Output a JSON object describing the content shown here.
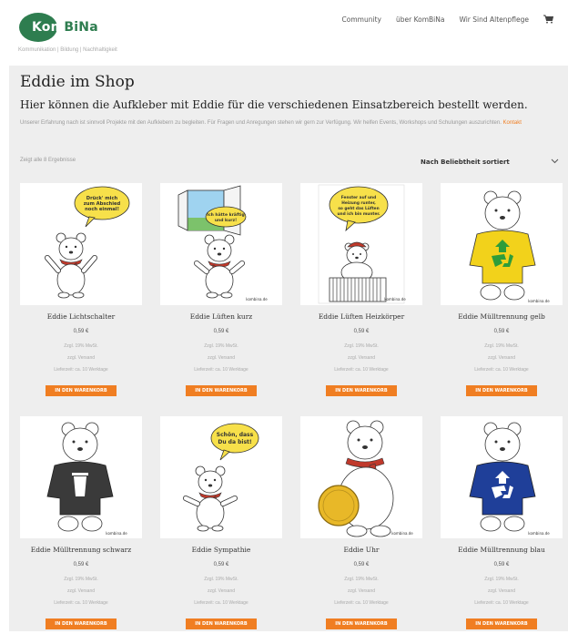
{
  "header": {
    "logo": {
      "part1": "Kom",
      "part2": "BiNa"
    },
    "tagline": "Kommunikation | Bildung | Nachhaltigkeit",
    "nav": [
      "Community",
      "über KomBiNa",
      "Wir Sind Altenpflege"
    ],
    "cart_icon": "shopping-cart-icon"
  },
  "page": {
    "title": "Eddie im Shop",
    "subtitle": "Hier können die Aufkleber mit Eddie für die verschiedenen Einsatzbereich bestellt werden.",
    "intro_text": "Unserer Erfahrung nach ist sinnvoll Projekte mit den Aufklebern zu begleiten. Für Fragen und Anregungen stehen wir gern zur Verfügung. Wir helfen Events, Workshops und Schulungen auszurichten.",
    "intro_link": "Kontakt",
    "result_count": "Zeigt alle 8 Ergebnisse",
    "sort_label": "Nach Beliebtheit sortiert"
  },
  "product_common": {
    "tax": "Zzgl. 19% MwSt.",
    "shipping": "zzgl. Versand",
    "delivery": "Lieferzeit: ca. 10 Werktage",
    "button": "IN DEN WARENKORB"
  },
  "products": [
    {
      "name": "Eddie Lichtschalter",
      "price": "0,59 €",
      "speech": [
        "Drück' mich",
        "zum Abschied",
        "noch einmal!"
      ],
      "image": "bear-waving-speech"
    },
    {
      "name": "Eddie Lüften kurz",
      "price": "0,59 €",
      "speech": [
        "Ich hätte kräftig",
        "und kurz!"
      ],
      "image": "bear-window"
    },
    {
      "name": "Eddie Lüften Heizkörper",
      "price": "0,59 €",
      "speech": [
        "Fenster auf und",
        "Heizung runter,",
        "so geht das Lüften",
        "und ich bin munter."
      ],
      "image": "bear-radiator"
    },
    {
      "name": "Eddie Mülltrennung gelb",
      "price": "0,59 €",
      "speech": [],
      "image": "bear-yellow-recycling"
    },
    {
      "name": "Eddie Mülltrennung schwarz",
      "price": "0,59 €",
      "speech": [],
      "image": "bear-black-bin"
    },
    {
      "name": "Eddie Sympathie",
      "price": "0,59 €",
      "speech": [
        "Schön, dass",
        "Du da bist!"
      ],
      "image": "bear-sympathy"
    },
    {
      "name": "Eddie Uhr",
      "price": "0,59 €",
      "speech": [],
      "image": "bear-gold-coin"
    },
    {
      "name": "Eddie Mülltrennung blau",
      "price": "0,59 €",
      "speech": [],
      "image": "bear-blue-recycling"
    }
  ],
  "watermark": "kombina.de",
  "colors": {
    "accent": "#f07e22",
    "brand_green": "#2e7d4f",
    "scarf_red": "#c0392b",
    "yellow_shirt": "#f2d21b",
    "black_shirt": "#3a3a3a",
    "blue_shirt": "#1f3f99",
    "recycle_green": "#2e9d3a"
  }
}
